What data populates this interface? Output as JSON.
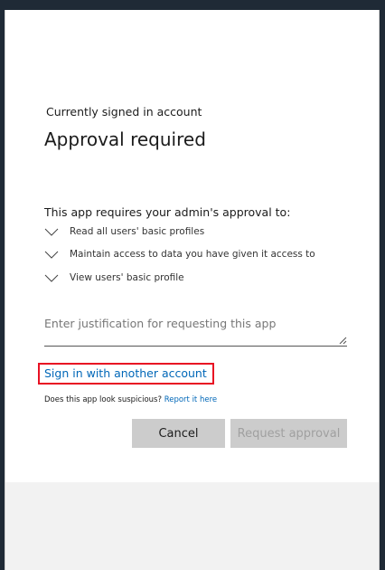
{
  "dialog": {
    "account_label": "Currently signed in account",
    "title": "Approval required",
    "intro": "This app requires your admin's approval to:",
    "permissions": [
      "Read all users' basic profiles",
      "Maintain access to data you have given it access to",
      "View users' basic profile"
    ],
    "justification_placeholder": "Enter justification for requesting this app",
    "signin_link": "Sign in with another account",
    "suspicious_text": "Does this app look suspicious?",
    "report_link": "Report it here",
    "cancel_label": "Cancel",
    "request_label": "Request approval"
  },
  "colors": {
    "link": "#0067b8",
    "highlight_border": "#e81123",
    "button_bg": "#cccccc"
  },
  "icons": {
    "permission": "chevron-down-icon",
    "resize": "resize-grip-icon"
  }
}
